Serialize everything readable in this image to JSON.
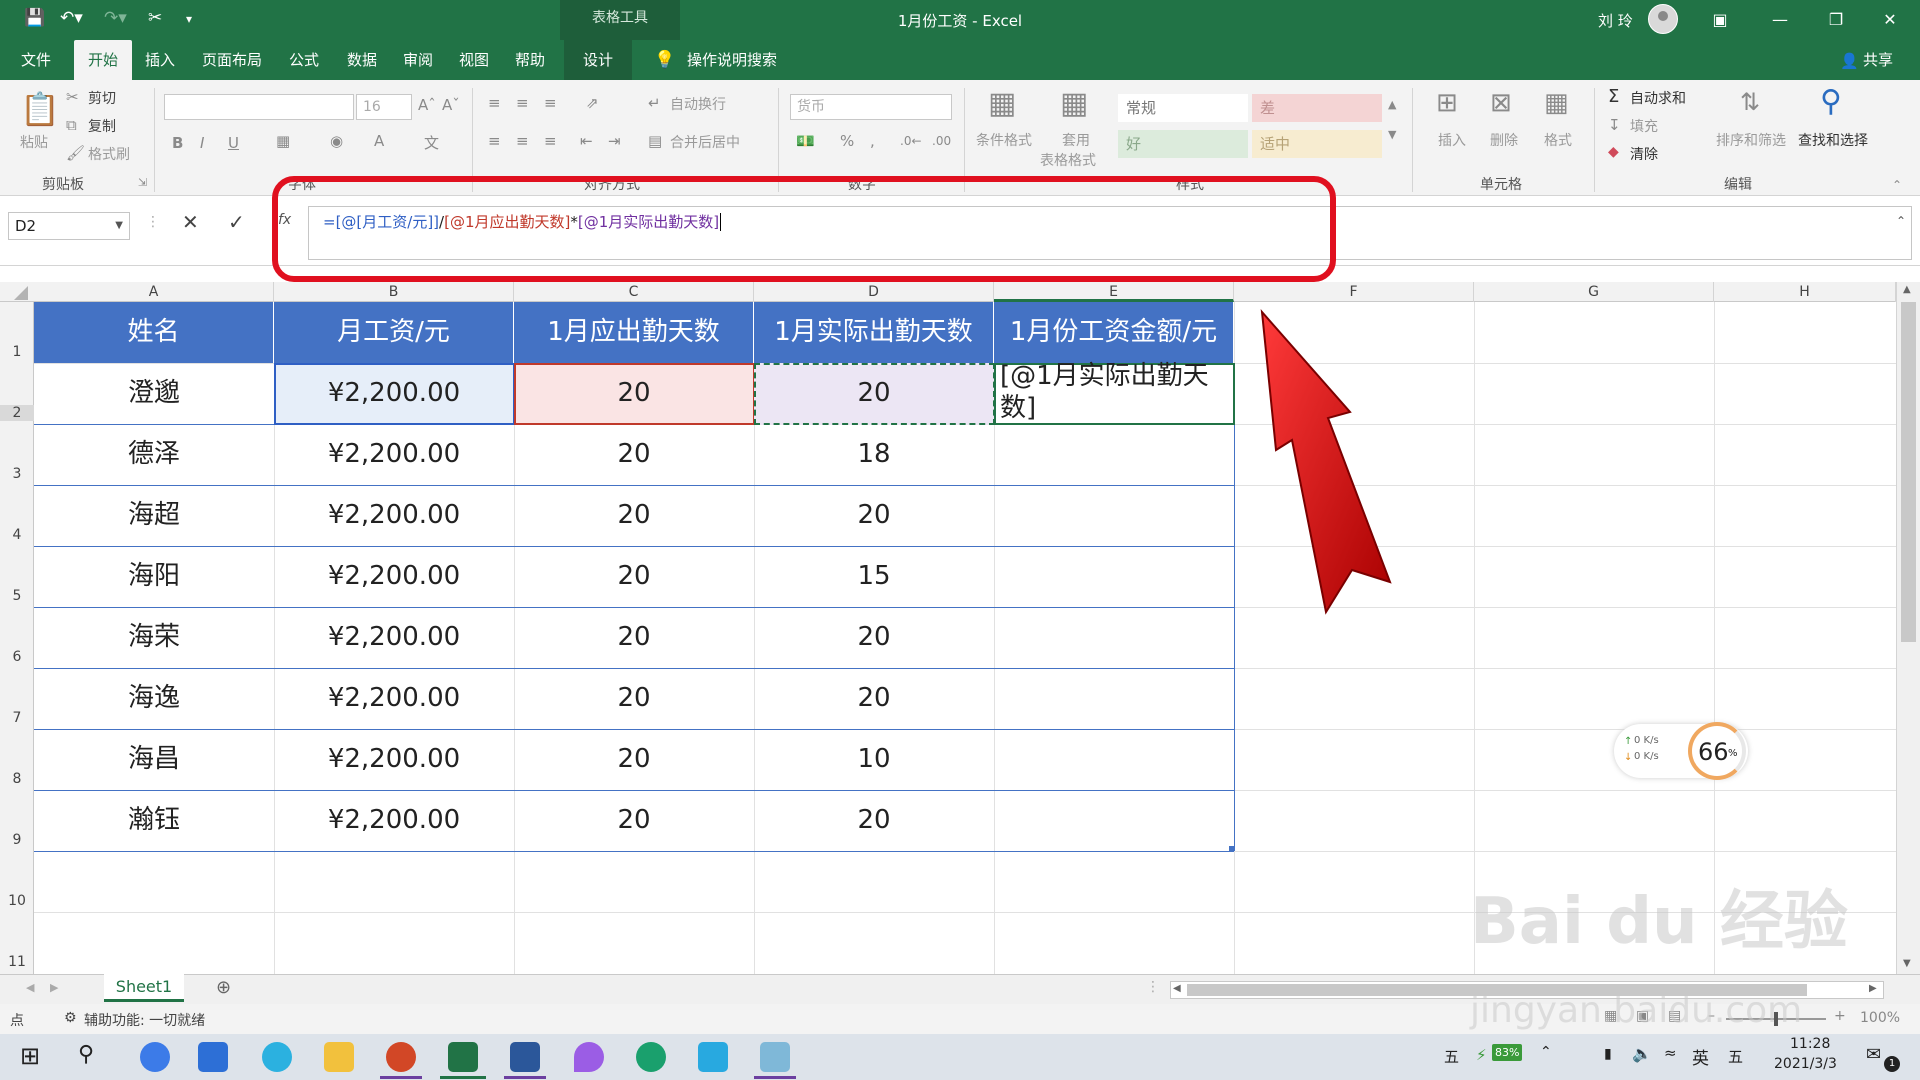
{
  "titlebar": {
    "context_tab": "表格工具",
    "title": "1月份工资 - Excel",
    "user": "刘 玲"
  },
  "tabs": [
    "文件",
    "开始",
    "插入",
    "页面布局",
    "公式",
    "数据",
    "审阅",
    "视图",
    "帮助",
    "设计"
  ],
  "tell_me": "操作说明搜索",
  "share": "共享",
  "ribbon": {
    "clipboard": {
      "paste": "粘贴",
      "cut": "剪切",
      "copy": "复制",
      "format_painter": "格式刷",
      "label": "剪贴板"
    },
    "font": {
      "size": "16",
      "label": "字体"
    },
    "alignment": {
      "wrap": "自动换行",
      "merge": "合并后居中",
      "label": "对齐方式"
    },
    "number": {
      "format": "货币",
      "label": "数字"
    },
    "styles": {
      "cond_format": "条件格式",
      "table_format_1": "套用",
      "table_format_2": "表格格式",
      "normal": "常规",
      "bad": "差",
      "good": "好",
      "neutral": "适中",
      "label": "样式"
    },
    "cells": {
      "insert": "插入",
      "delete": "删除",
      "format": "格式",
      "label": "单元格"
    },
    "editing": {
      "autosum": "自动求和",
      "fill": "填充",
      "clear": "清除",
      "sort": "排序和筛选",
      "find": "查找和选择",
      "label": "编辑"
    }
  },
  "formula_bar": {
    "name_box": "D2",
    "fx": "fx",
    "formula_p1": "=[@[月工资/元]]",
    "formula_p2": "/",
    "formula_p3": "[@1月应出勤天数]",
    "formula_p4": "*",
    "formula_p5": "[@1月实际出勤天数]"
  },
  "columns": [
    "A",
    "B",
    "C",
    "D",
    "E",
    "F",
    "G",
    "H"
  ],
  "rows": [
    "1",
    "2",
    "3",
    "4",
    "5",
    "6",
    "7",
    "8",
    "9",
    "10",
    "11"
  ],
  "table": {
    "headers": [
      "姓名",
      "月工资/元",
      "1月应出勤天数",
      "1月实际出勤天数",
      "1月份工资金额/元"
    ],
    "rows": [
      [
        "澄邈",
        "¥2,200.00",
        "20",
        "20"
      ],
      [
        "德泽",
        "¥2,200.00",
        "20",
        "18"
      ],
      [
        "海超",
        "¥2,200.00",
        "20",
        "20"
      ],
      [
        "海阳",
        "¥2,200.00",
        "20",
        "15"
      ],
      [
        "海荣",
        "¥2,200.00",
        "20",
        "20"
      ],
      [
        "海逸",
        "¥2,200.00",
        "20",
        "20"
      ],
      [
        "海昌",
        "¥2,200.00",
        "20",
        "10"
      ],
      [
        "瀚钰",
        "¥2,200.00",
        "20",
        "20"
      ]
    ],
    "editing_cell": "[@1月实际出勤天数]"
  },
  "sheet_tab": "Sheet1",
  "status": {
    "mode": "点",
    "accessibility": "辅助功能: 一切就绪",
    "zoom": "100%"
  },
  "net_widget": {
    "up": "0 K/s",
    "down": "0 K/s",
    "percent": "66",
    "unit": "%"
  },
  "taskbar": {
    "ime_1": "五",
    "battery": "83%",
    "lang": "英",
    "ime_2": "五",
    "time": "11:28",
    "date": "2021/3/3",
    "notif": "1"
  },
  "watermark": {
    "brand": "Bai du 经验",
    "url": "jingyan.baidu.com"
  },
  "colors": {
    "excel_green": "#217346",
    "table_header": "#4472c4",
    "highlight_red": "#e0101f",
    "formula_blue": "#2f5fc4",
    "formula_red": "#c0392b",
    "formula_purple": "#7030a0"
  }
}
